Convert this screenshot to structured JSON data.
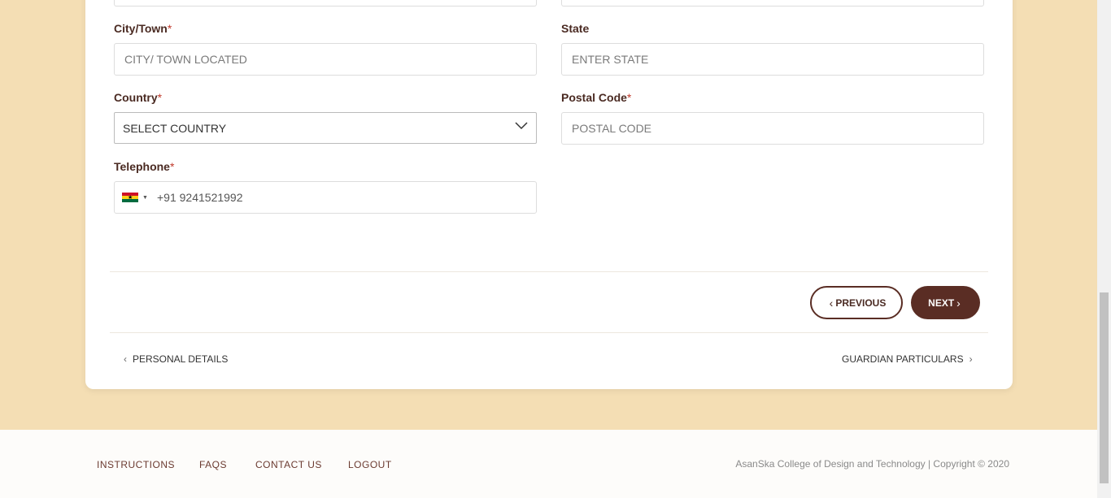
{
  "form": {
    "city": {
      "label": "City/Town",
      "required": "*",
      "placeholder": "CITY/ TOWN LOCATED"
    },
    "state": {
      "label": "State",
      "placeholder": "ENTER STATE"
    },
    "country": {
      "label": "Country",
      "required": "*",
      "selected": "SELECT COUNTRY"
    },
    "postal": {
      "label": "Postal Code",
      "required": "*",
      "placeholder": "POSTAL CODE"
    },
    "telephone": {
      "label": "Telephone",
      "required": "*",
      "flag": "ghana-flag-icon",
      "value": "+91 9241521992"
    }
  },
  "buttons": {
    "previous": "PREVIOUS",
    "next": "NEXT"
  },
  "steps": {
    "prev": "PERSONAL DETAILS",
    "next": "GUARDIAN PARTICULARS"
  },
  "footer": {
    "nav": [
      "INSTRUCTIONS",
      "FAQS",
      "CONTACT US",
      "LOGOUT"
    ],
    "copyright": "AsanSka College of Design and Technology | Copyright © 2020"
  },
  "colors": {
    "page_bg": "#f4deb4",
    "brand": "#5a2d24",
    "required": "#c0392b"
  }
}
